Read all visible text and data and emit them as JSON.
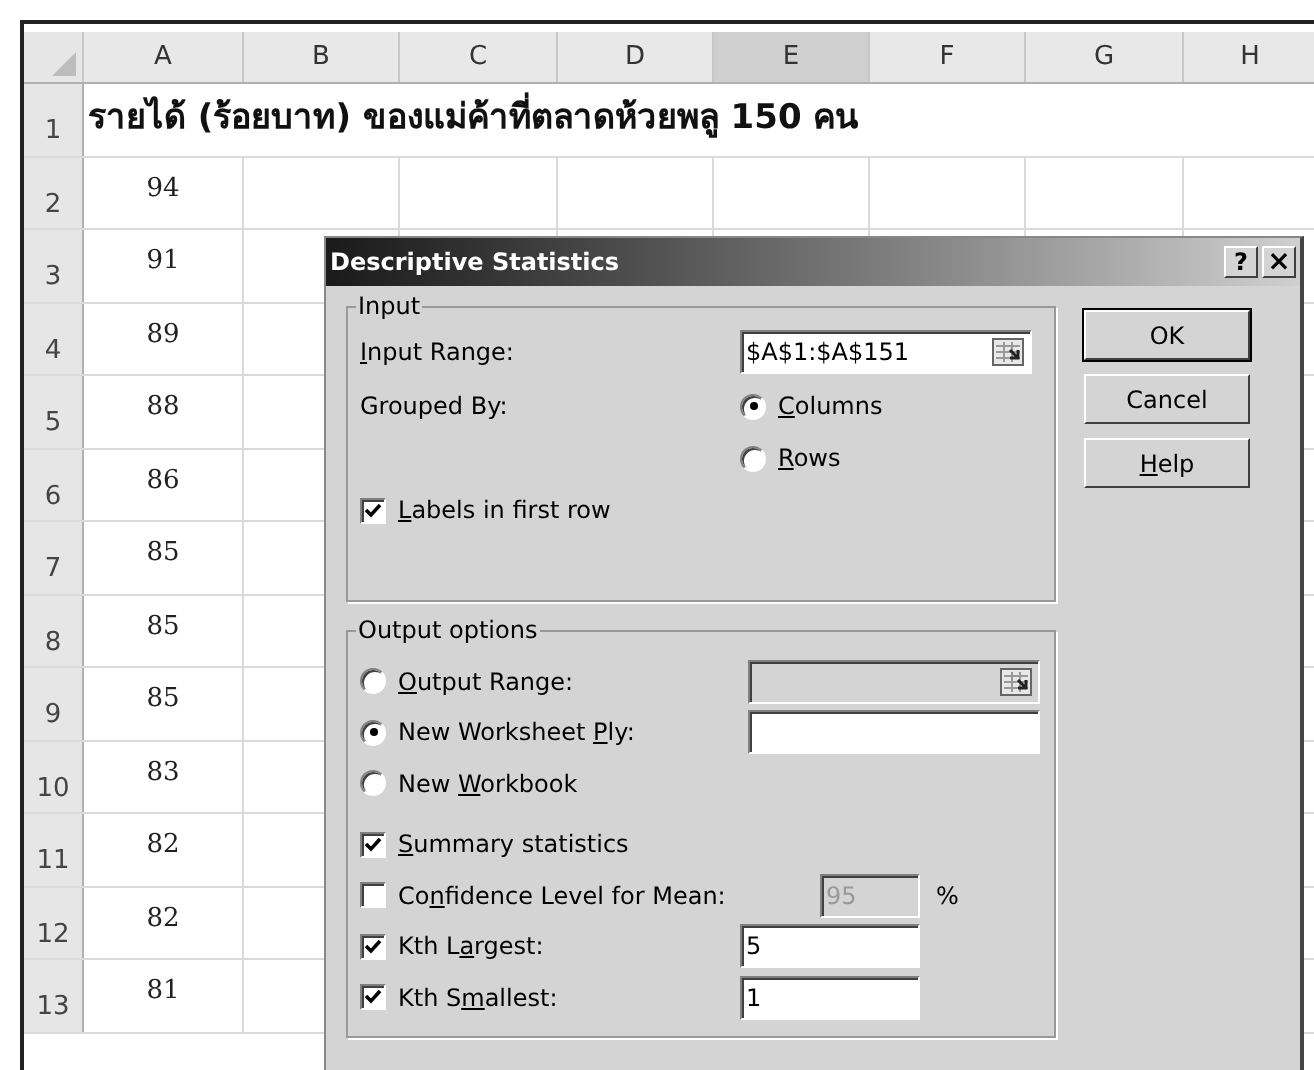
{
  "sheet": {
    "columns": [
      {
        "label": "A",
        "selected": false
      },
      {
        "label": "B",
        "selected": false
      },
      {
        "label": "C",
        "selected": false
      },
      {
        "label": "D",
        "selected": false
      },
      {
        "label": "E",
        "selected": true
      },
      {
        "label": "F",
        "selected": false
      },
      {
        "label": "G",
        "selected": false
      },
      {
        "label": "H",
        "selected": false
      }
    ],
    "rows": [
      {
        "number": "1",
        "title": "รายได้ (ร้อยบาท) ของแม่ค้าที่ตลาดห้วยพลู 150 คน"
      },
      {
        "number": "2",
        "value": "94"
      },
      {
        "number": "3",
        "value": "91"
      },
      {
        "number": "4",
        "value": "89"
      },
      {
        "number": "5",
        "value": "88"
      },
      {
        "number": "6",
        "value": "86"
      },
      {
        "number": "7",
        "value": "85"
      },
      {
        "number": "8",
        "value": "85"
      },
      {
        "number": "9",
        "value": "85"
      },
      {
        "number": "10",
        "value": "83"
      },
      {
        "number": "11",
        "value": "82"
      },
      {
        "number": "12",
        "value": "82"
      },
      {
        "number": "13",
        "value": "81"
      }
    ]
  },
  "dialog": {
    "title": "Descriptive Statistics",
    "help_glyph": "?",
    "close_glyph": "×",
    "input": {
      "title": "Input",
      "range": {
        "label": {
          "key": "I",
          "after": "nput Range:"
        },
        "value": "$A$1:$A$151",
        "ref_button": true
      },
      "grouped_by": {
        "label": "Grouped By:",
        "options": [
          {
            "label": {
              "key": "C",
              "after": "olumns"
            },
            "selected": true
          },
          {
            "label": {
              "key": "R",
              "after": "ows"
            },
            "selected": false
          }
        ]
      },
      "labels_checkbox": {
        "label": {
          "key": "L",
          "after": "abels in first row"
        },
        "checked": true
      }
    },
    "output": {
      "title": "Output options",
      "items": [
        {
          "kind": "radio",
          "label": {
            "key": "O",
            "after": "utput Range:"
          },
          "selected": false,
          "field": {
            "disabled": true,
            "ref_button": true
          }
        },
        {
          "kind": "radio",
          "label": {
            "before": "New Worksheet ",
            "key": "P",
            "after": "ly:"
          },
          "selected": true,
          "field": {
            "disabled": false
          }
        },
        {
          "kind": "radio",
          "label": {
            "before": "New ",
            "key": "W",
            "after": "orkbook"
          },
          "selected": false
        },
        {
          "kind": "checkbox",
          "label": {
            "key": "S",
            "after": "ummary statistics"
          },
          "checked": true
        },
        {
          "kind": "checkbox",
          "label": {
            "before": "Co",
            "key": "n",
            "after": "fidence Level for Mean:"
          },
          "checked": false,
          "field": {
            "value": "95",
            "disabled": true
          },
          "suffix": "%"
        },
        {
          "kind": "checkbox",
          "label": {
            "before": "Kth L",
            "key": "a",
            "after": "rgest:"
          },
          "checked": true,
          "field": {
            "value": "5",
            "disabled": false
          }
        },
        {
          "kind": "checkbox",
          "label": {
            "before": "Kth S",
            "key": "m",
            "after": "allest:"
          },
          "checked": true,
          "field": {
            "value": "1",
            "disabled": false
          }
        }
      ]
    },
    "buttons": [
      {
        "label": {
          "before": "OK"
        },
        "default": true
      },
      {
        "label": {
          "before": "Cancel"
        },
        "default": false
      },
      {
        "label": {
          "key": "H",
          "after": "elp"
        },
        "default": false
      }
    ]
  }
}
